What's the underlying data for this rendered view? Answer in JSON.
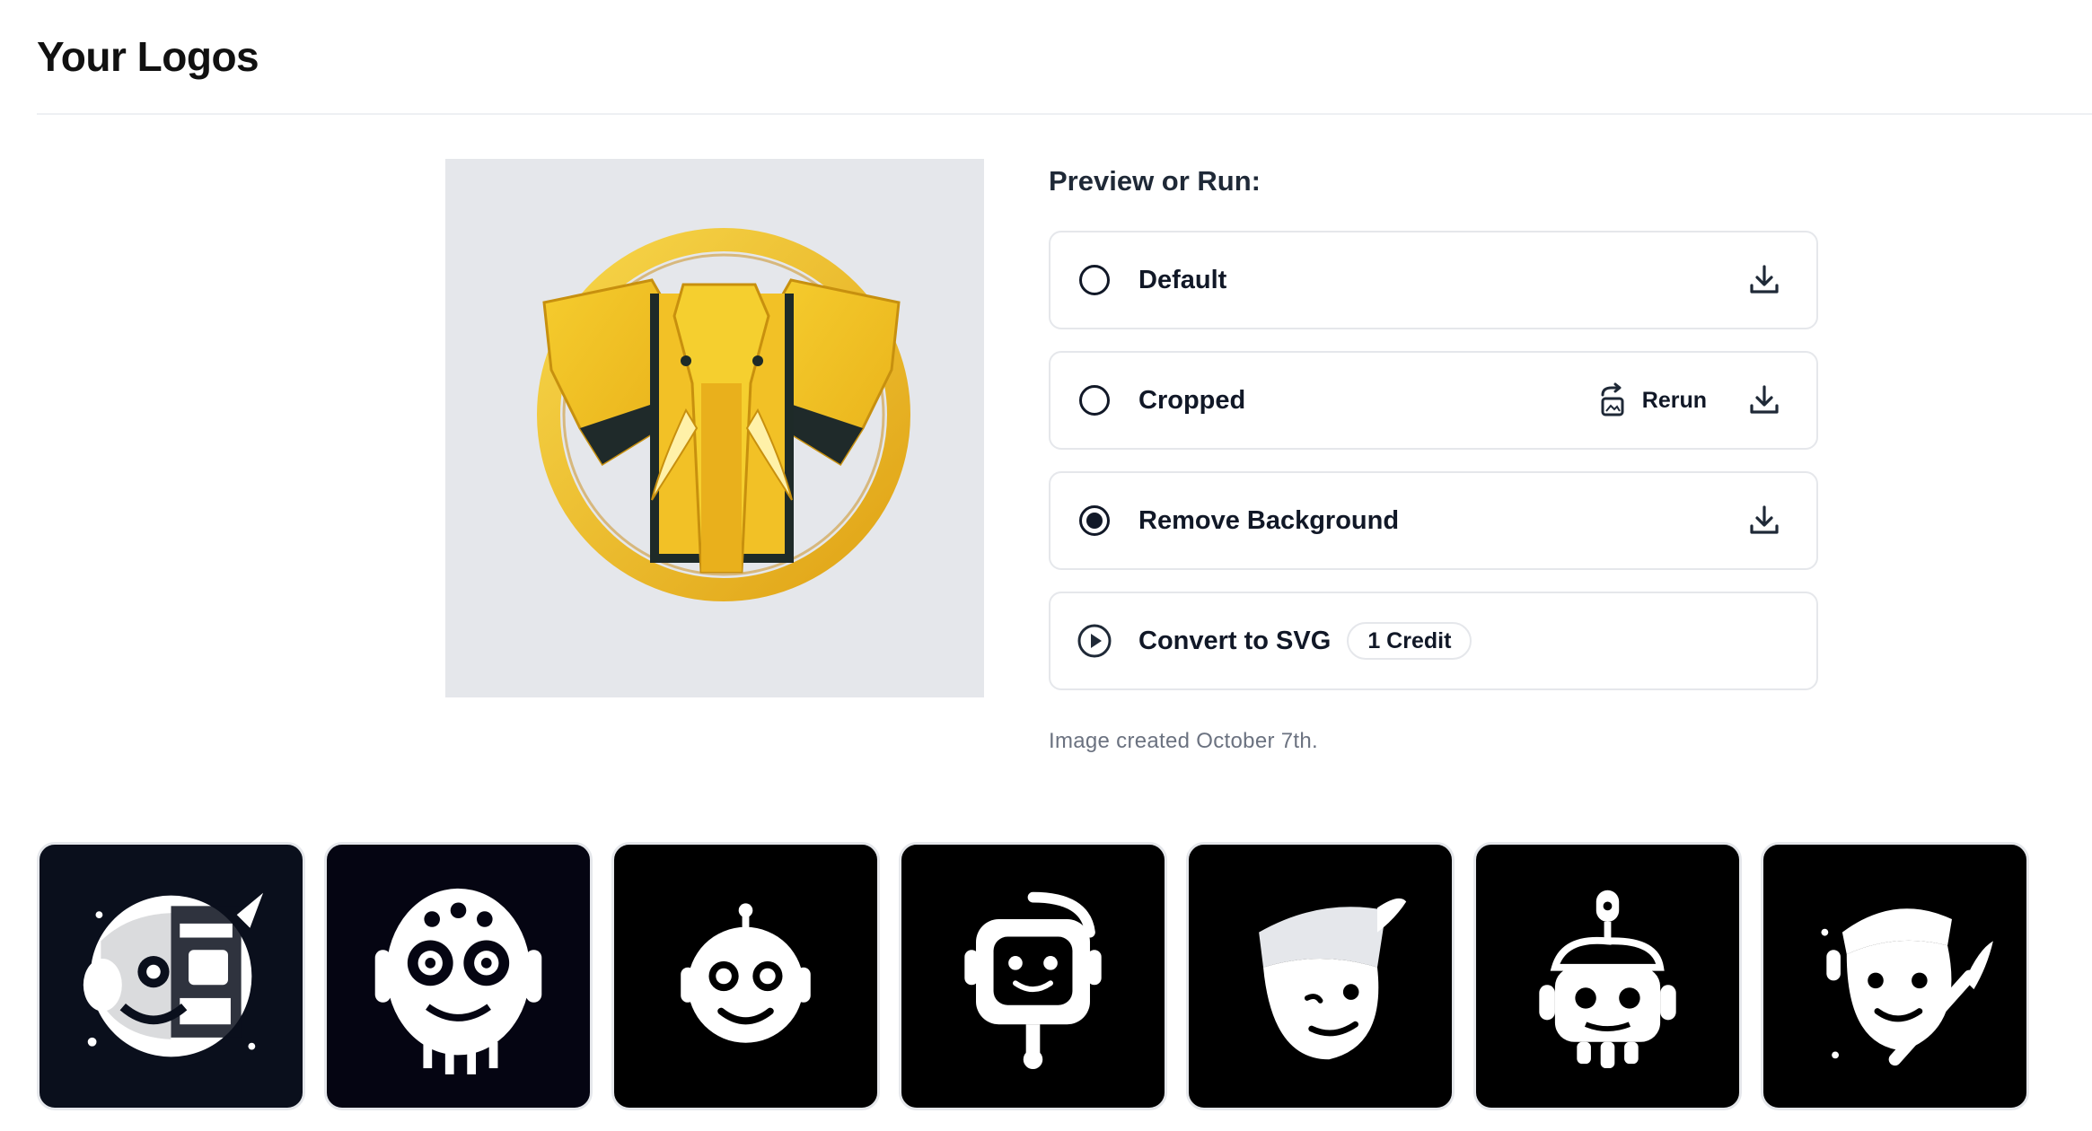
{
  "page": {
    "title": "Your Logos"
  },
  "preview": {
    "image_alt": "Yellow geometric elephant head logo inside a golden ring"
  },
  "options": {
    "heading": "Preview or Run:",
    "items": [
      {
        "label": "Default",
        "selected": false,
        "icon": "radio",
        "actions": [
          "download-icon"
        ]
      },
      {
        "label": "Cropped",
        "selected": false,
        "icon": "radio",
        "actions": [
          "rerun",
          "download-icon"
        ],
        "rerun_label": "Rerun"
      },
      {
        "label": "Remove Background",
        "selected": true,
        "icon": "radio",
        "actions": [
          "download-icon"
        ]
      },
      {
        "label": "Convert to SVG",
        "selected": false,
        "icon": "play-icon",
        "badge": "1 Credit"
      }
    ],
    "created_note": "Image created October 7th."
  },
  "thumbnails": [
    {
      "name": "abstract-face-logo",
      "bg": "#0a0f1c"
    },
    {
      "name": "ornate-monkey-face-logo",
      "bg": "#050512"
    },
    {
      "name": "round-robot-logo",
      "bg": "#000000"
    },
    {
      "name": "square-robot-logo",
      "bg": "#000000"
    },
    {
      "name": "cap-face-logo",
      "bg": "#000000"
    },
    {
      "name": "skull-robot-logo",
      "bg": "#000000"
    },
    {
      "name": "painter-face-logo",
      "bg": "#000000"
    }
  ],
  "colors": {
    "accent_yellow": "#f5c518",
    "border": "#e5e7eb",
    "text": "#111827",
    "muted": "#6b7280"
  }
}
